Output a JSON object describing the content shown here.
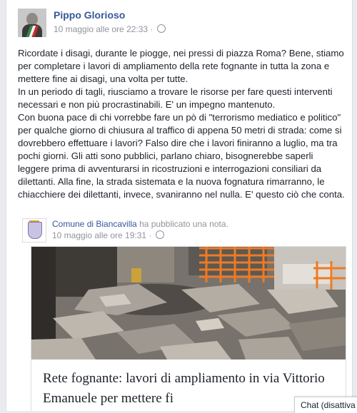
{
  "post": {
    "author": "Pippo Glorioso",
    "timestamp": "10 maggio alle ore 22:33 ·",
    "paragraphs": [
      "Ricordate i disagi, durante le piogge, nei pressi di piazza Roma? Bene, stiamo per completare i lavori di ampliamento della rete fognante in tutta la zona e mettere fine ai disagi, una volta per tutte.",
      "In un periodo di tagli, riusciamo a trovare le risorse per fare questi interventi necessari e non più procrastinabili. E' un impegno mantenuto.",
      "Con buona pace di chi vorrebbe fare un pò di \"terrorismo mediatico e politico\" per qualche giorno di chiusura al traffico di appena 50 metri di strada: come si dovrebbero effettuare i lavori? Falso dire che i lavori finiranno a luglio, ma tra pochi giorni. Gli atti sono pubblici, parlano chiaro, bisognerebbe saperli leggere prima di avventurarsi in ricostruzioni e interrogazioni consiliari da dilettanti. Alla fine, la strada sistemata e la nuova fognatura rimarranno, le chiacchiere dei dilettanti, invece, svaniranno nel nulla. E' questo ciò che conta."
    ]
  },
  "shared": {
    "page_name": "Comune di Biancavilla",
    "action": " ha pubblicato una nota.",
    "timestamp": "10 maggio alle ore 19:31 ·"
  },
  "link": {
    "title": "Rete fognante: lavori di ampliamento in via Vittorio Emanuele per mettere fi"
  },
  "chat": {
    "label": "Chat (disattiva"
  },
  "colors": {
    "link_blue": "#365899",
    "meta_gray": "#90949c",
    "barrier_orange": "#f07a22"
  },
  "icons": {
    "privacy": "globe-icon"
  }
}
